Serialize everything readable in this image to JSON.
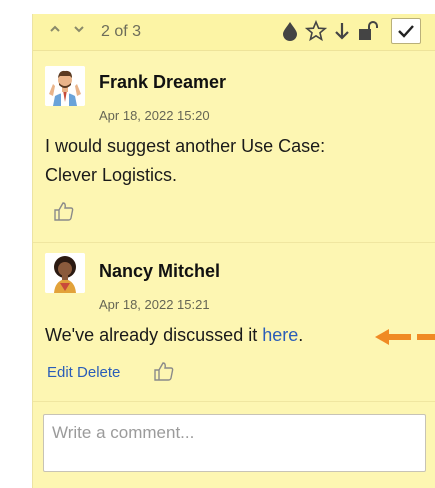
{
  "toolbar": {
    "counter": "2 of 3",
    "icons": [
      "chevron-up-icon",
      "chevron-down-icon",
      "drop-icon",
      "star-icon",
      "arrow-down-icon",
      "unlock-icon",
      "check-icon"
    ]
  },
  "comments": [
    {
      "author": "Frank Dreamer",
      "date": "Apr 18, 2022 15:20",
      "text_line1": "I would suggest another Use Case:",
      "text_line2": "Clever Logistics."
    },
    {
      "author": "Nancy Mitchel",
      "date": "Apr 18, 2022 15:21",
      "text_before_link": "We've already discussed it ",
      "link_text": "here",
      "text_after_link": ".",
      "edit_label": "Edit",
      "delete_label": "Delete"
    }
  ],
  "comment_input": {
    "placeholder": "Write a comment..."
  },
  "colors": {
    "panel": "#fdf6b2",
    "link": "#2a5db8",
    "arrow": "#f08a24"
  }
}
